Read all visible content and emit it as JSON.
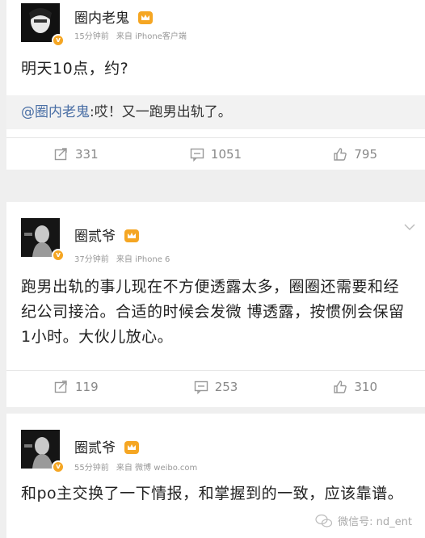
{
  "posts": [
    {
      "author": "圈内老鬼",
      "time": "15分钟前",
      "source": "来自 iPhone客户端",
      "text": "明天10点，约?",
      "quote_mention": "@圈内老鬼",
      "quote_text": ":哎！又一跑男出轨了。",
      "reposts": "331",
      "comments": "1051",
      "likes": "795"
    },
    {
      "author": "圈贰爷",
      "time": "37分钟前",
      "source": "来自 iPhone 6",
      "text": "跑男出轨的事儿现在不方便透露太多，圈圈还需要和经纪公司接洽。合适的时候会发微 博透露，按惯例会保留1小时。大伙儿放心。",
      "reposts": "119",
      "comments": "253",
      "likes": "310"
    },
    {
      "author": "圈贰爷",
      "time": "55分钟前",
      "source": "来自 微博 weibo.com",
      "text": "和po主交换了一下情报，和掌握到的一致，应该靠谱。"
    }
  ],
  "watermark": "微信号: nd_ent",
  "icons": {
    "repost": "repost-icon",
    "comment": "comment-icon",
    "like": "thumbs-up-icon",
    "verified": "verified-badge-icon",
    "member": "vip-crown-icon",
    "menu": "chevron-down-icon",
    "wechat": "wechat-icon"
  },
  "colors": {
    "mention": "#4a6fa5",
    "badge": "#f5a623",
    "meta": "#999999"
  }
}
